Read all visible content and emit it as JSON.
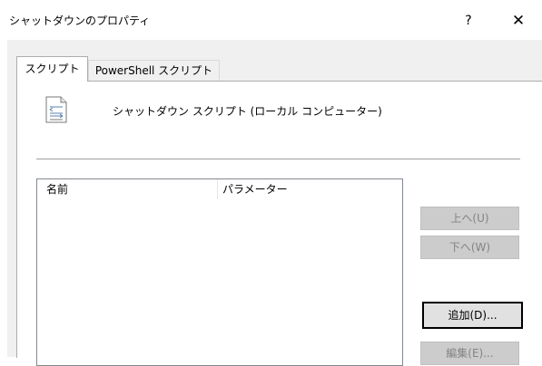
{
  "window": {
    "title": "シャットダウンのプロパティ",
    "help_label": "?",
    "close_label": "✕"
  },
  "tabs": [
    {
      "label": "スクリプト",
      "active": true
    },
    {
      "label": "PowerShell スクリプト",
      "active": false
    }
  ],
  "panel": {
    "heading": "シャットダウン スクリプト (ローカル コンピューター)",
    "icon": "script-file-icon"
  },
  "list": {
    "columns": [
      "名前",
      "パラメーター"
    ],
    "rows": []
  },
  "buttons": {
    "up": "上へ(U)",
    "down": "下へ(W)",
    "add": "追加(D)...",
    "edit": "編集(E)..."
  },
  "colors": {
    "dialog_background": "#f0f0f0",
    "disabled_button": "#cccccc",
    "default_button_border": "#000000"
  }
}
